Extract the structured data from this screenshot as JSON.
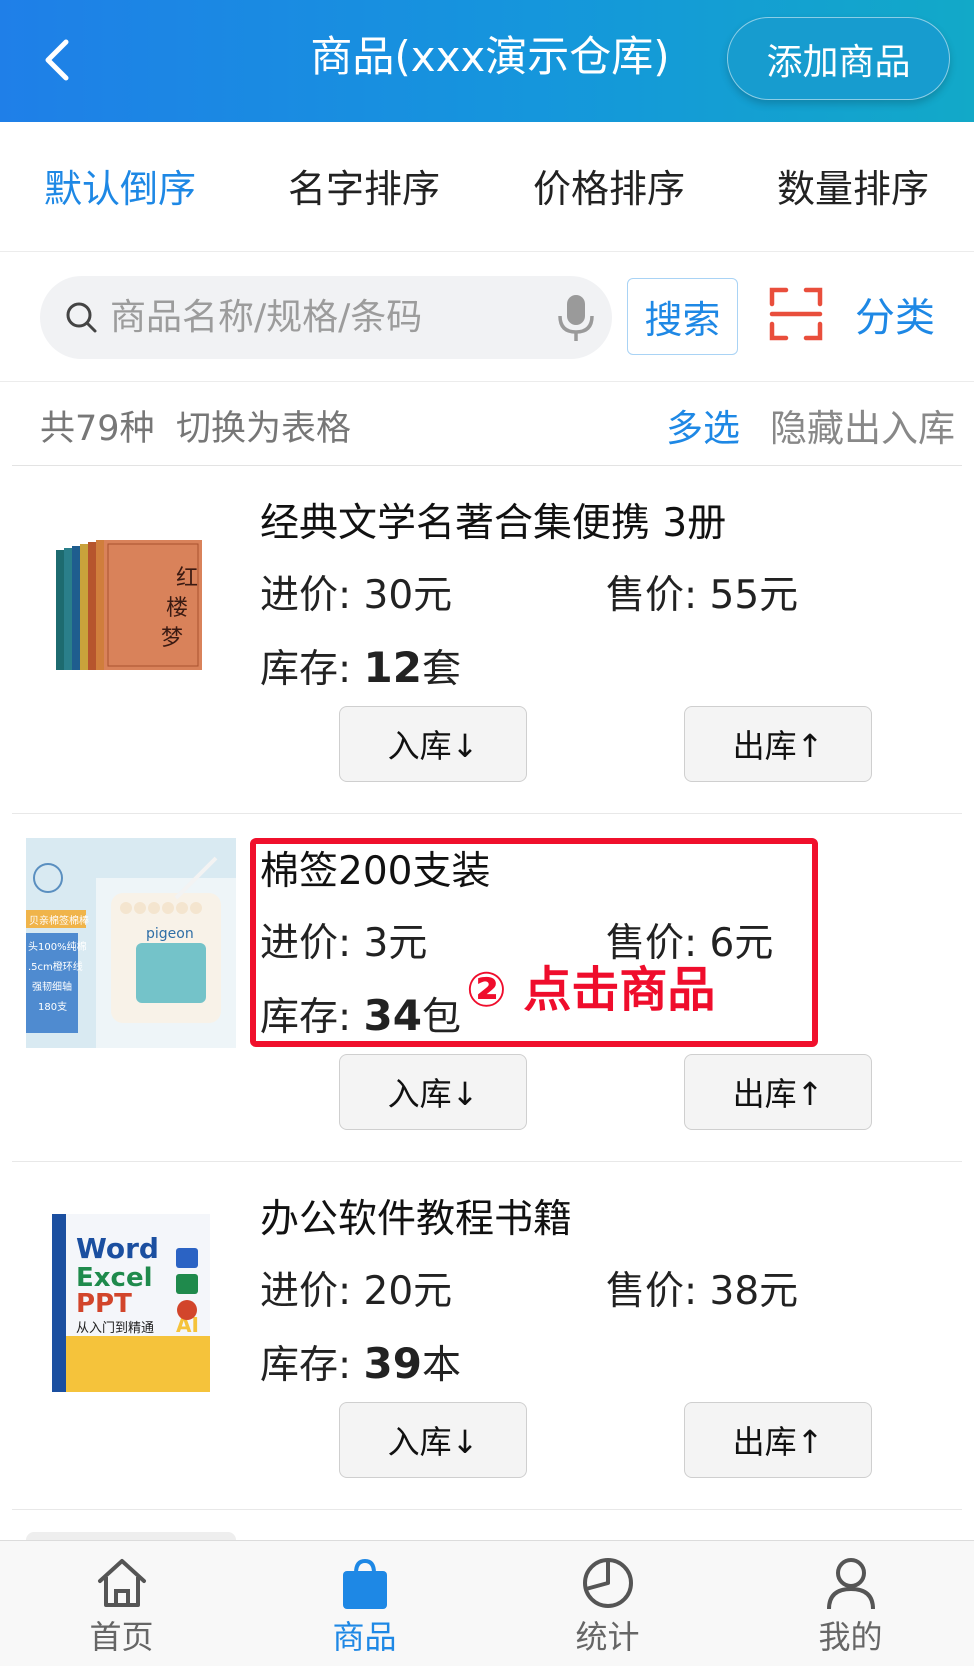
{
  "header": {
    "title": "商品(xxx演示仓库)",
    "add_button": "添加商品",
    "back_icon": "chevron-left-icon"
  },
  "sort_tabs": [
    {
      "label": "默认倒序",
      "active": true
    },
    {
      "label": "名字排序",
      "active": false
    },
    {
      "label": "价格排序",
      "active": false
    },
    {
      "label": "数量排序",
      "active": false
    }
  ],
  "search": {
    "placeholder": "商品名称/规格/条码",
    "value": "",
    "button": "搜索",
    "category": "分类",
    "icons": {
      "search": "search-icon",
      "mic": "mic-icon",
      "scan": "scan-icon"
    }
  },
  "info": {
    "count": "共79种",
    "switch_table": "切换为表格",
    "multi_select": "多选",
    "hide_inout": "隐藏出入库"
  },
  "products": [
    {
      "name": "经典文学名著合集便携   3册",
      "cost_label": "进价:",
      "cost": "30元",
      "price_label": "售价:",
      "price": "55元",
      "stock_label": "库存:",
      "stock_num": "12",
      "stock_unit": "套",
      "in_button": "入库↓",
      "out_button": "出库↑"
    },
    {
      "name": "棉签200支装",
      "cost_label": "进价:",
      "cost": "3元",
      "price_label": "售价:",
      "price": "6元",
      "stock_label": "库存:",
      "stock_num": "34",
      "stock_unit": "包",
      "in_button": "入库↓",
      "out_button": "出库↑",
      "thumb_text": [
        "贝亲棉签棉棒",
        "头100%纯棉",
        ".5cm橙环线",
        "强韧细轴",
        "180支"
      ]
    },
    {
      "name": "办公软件教程书籍",
      "cost_label": "进价:",
      "cost": "20元",
      "price_label": "售价:",
      "price": "38元",
      "stock_label": "库存:",
      "stock_num": "39",
      "stock_unit": "本",
      "in_button": "入库↓",
      "out_button": "出库↑",
      "thumb_text": [
        "Word",
        "Excel",
        "PPT",
        "从入门到精通",
        "AI"
      ]
    }
  ],
  "annotation": {
    "text": "② 点击商品",
    "color": "#ef0d2c"
  },
  "bottom_nav": [
    {
      "label": "首页",
      "icon": "home-icon",
      "active": false
    },
    {
      "label": "商品",
      "icon": "shopping-bag-icon",
      "active": true
    },
    {
      "label": "统计",
      "icon": "pie-chart-icon",
      "active": false
    },
    {
      "label": "我的",
      "icon": "user-icon",
      "active": false
    }
  ],
  "colors": {
    "accent": "#1e88e5",
    "header_start": "#1f7fe8",
    "header_end": "#12a9c8",
    "scan": "#e94e3c"
  }
}
